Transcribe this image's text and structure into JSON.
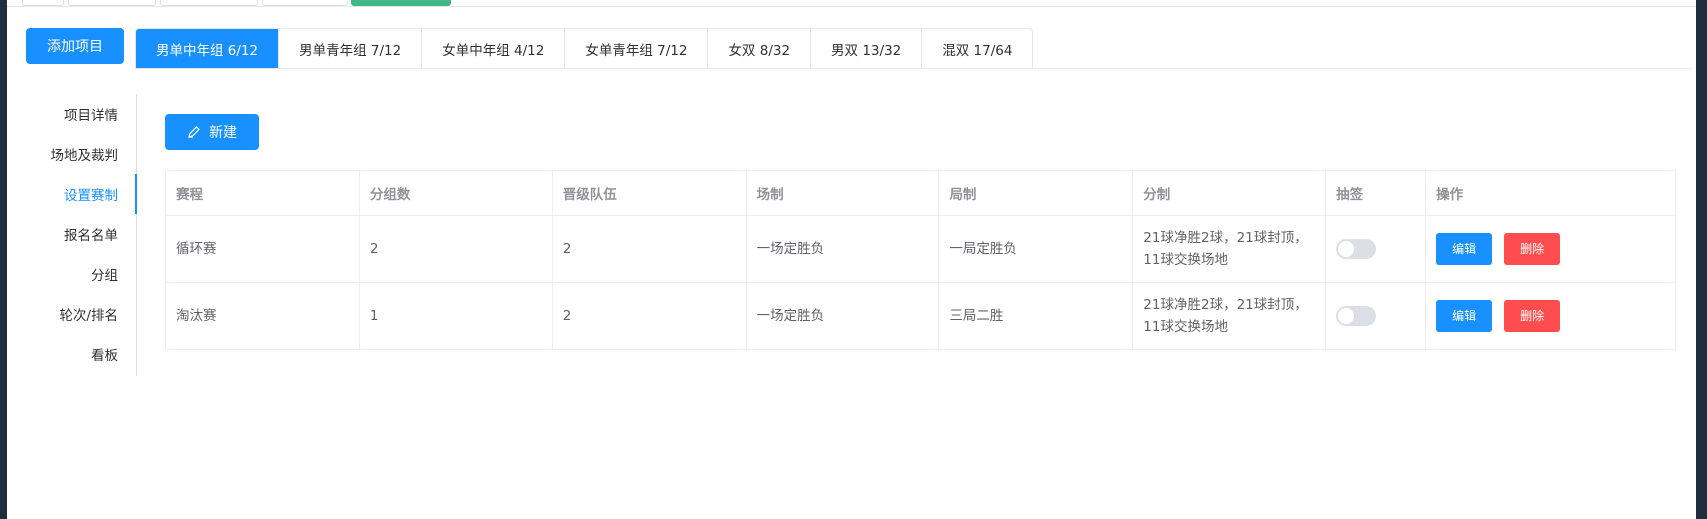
{
  "toolbar": {
    "add_project_label": "添加项目"
  },
  "tabs": [
    {
      "label": "男单中年组 6/12",
      "active": true
    },
    {
      "label": "男单青年组 7/12",
      "active": false
    },
    {
      "label": "女单中年组 4/12",
      "active": false
    },
    {
      "label": "女单青年组 7/12",
      "active": false
    },
    {
      "label": "女双 8/32",
      "active": false
    },
    {
      "label": "男双 13/32",
      "active": false
    },
    {
      "label": "混双 17/64",
      "active": false
    }
  ],
  "sidebar": {
    "items": [
      {
        "label": "项目详情"
      },
      {
        "label": "场地及裁判"
      },
      {
        "label": "设置赛制",
        "active": true
      },
      {
        "label": "报名名单"
      },
      {
        "label": "分组"
      },
      {
        "label": "轮次/排名"
      },
      {
        "label": "看板"
      }
    ]
  },
  "main": {
    "new_label": "新建",
    "new_icon": "edit-icon",
    "table": {
      "headers": [
        "赛程",
        "分组数",
        "晋级队伍",
        "场制",
        "局制",
        "分制",
        "抽签",
        "操作"
      ],
      "rows": [
        {
          "stage": "循环赛",
          "groups": "2",
          "advance": "2",
          "match_format": "一场定胜负",
          "game_format": "一局定胜负",
          "scoring_line1": "21球净胜2球，21球封顶，",
          "scoring_line2": "11球交换场地",
          "draw_enabled": false,
          "edit_label": "编辑",
          "delete_label": "删除"
        },
        {
          "stage": "淘汰赛",
          "groups": "1",
          "advance": "2",
          "match_format": "一场定胜负",
          "game_format": "三局二胜",
          "scoring_line1": "21球净胜2球，21球封顶，",
          "scoring_line2": "11球交换场地",
          "draw_enabled": false,
          "edit_label": "编辑",
          "delete_label": "删除"
        }
      ]
    }
  },
  "colors": {
    "primary": "#1890ff",
    "danger": "#ff4d4f",
    "top_accent": "#42b983"
  }
}
